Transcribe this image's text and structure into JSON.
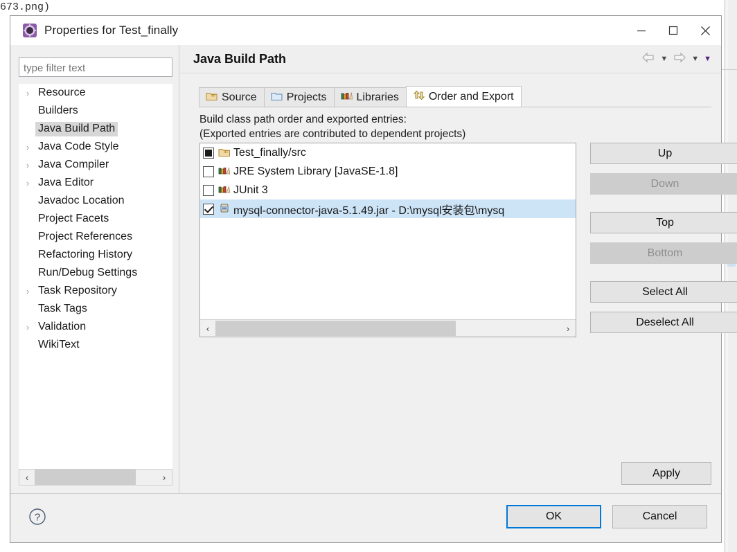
{
  "background": {
    "text_fragment": "673.png)"
  },
  "window": {
    "title": "Properties for Test_finally",
    "icon": "eclipse-icon",
    "controls": {
      "minimize": "minimize-icon",
      "maximize": "maximize-icon",
      "close": "close-icon"
    }
  },
  "sidebar": {
    "filter": {
      "value": "",
      "placeholder": "type filter text"
    },
    "items": [
      {
        "label": "Resource",
        "expandable": true,
        "selected": false
      },
      {
        "label": "Builders",
        "expandable": false,
        "selected": false
      },
      {
        "label": "Java Build Path",
        "expandable": false,
        "selected": true
      },
      {
        "label": "Java Code Style",
        "expandable": true,
        "selected": false
      },
      {
        "label": "Java Compiler",
        "expandable": true,
        "selected": false
      },
      {
        "label": "Java Editor",
        "expandable": true,
        "selected": false
      },
      {
        "label": "Javadoc Location",
        "expandable": false,
        "selected": false
      },
      {
        "label": "Project Facets",
        "expandable": false,
        "selected": false
      },
      {
        "label": "Project References",
        "expandable": false,
        "selected": false
      },
      {
        "label": "Refactoring History",
        "expandable": false,
        "selected": false
      },
      {
        "label": "Run/Debug Settings",
        "expandable": false,
        "selected": false
      },
      {
        "label": "Task Repository",
        "expandable": true,
        "selected": false
      },
      {
        "label": "Task Tags",
        "expandable": false,
        "selected": false
      },
      {
        "label": "Validation",
        "expandable": true,
        "selected": false
      },
      {
        "label": "WikiText",
        "expandable": false,
        "selected": false
      }
    ],
    "scrollbar": {
      "left_arrow": "‹",
      "right_arrow": "›"
    }
  },
  "page": {
    "title": "Java Build Path",
    "nav": {
      "back": "back-arrow-icon",
      "back_caret": "▼",
      "forward": "forward-arrow-icon",
      "forward_caret": "▼",
      "menu_caret": "▼"
    },
    "tabs": [
      {
        "label": "Source",
        "icon": "source-folder-icon",
        "active": false
      },
      {
        "label": "Projects",
        "icon": "projects-folder-icon",
        "active": false
      },
      {
        "label": "Libraries",
        "icon": "libraries-books-icon",
        "active": false
      },
      {
        "label": "Order and Export",
        "icon": "order-export-icon",
        "active": true
      }
    ],
    "description_line1": "Build class path order and exported entries:",
    "description_line2": "(Exported entries are contributed to dependent projects)",
    "entries": [
      {
        "label": "Test_finally/src",
        "icon": "source-folder-icon",
        "checkbox": "filled",
        "selected": false
      },
      {
        "label": "JRE System Library [JavaSE-1.8]",
        "icon": "libraries-books-icon",
        "checkbox": "unchecked",
        "selected": false
      },
      {
        "label": "JUnit 3",
        "icon": "libraries-books-icon",
        "checkbox": "unchecked",
        "selected": false
      },
      {
        "label": "mysql-connector-java-5.1.49.jar - D:\\mysql安装包\\mysq",
        "icon": "jar-icon",
        "checkbox": "checked",
        "selected": true
      }
    ],
    "list_scrollbar": {
      "left_arrow": "‹",
      "right_arrow": "›"
    },
    "side_buttons": [
      {
        "label": "Up",
        "enabled": true
      },
      {
        "label": "Down",
        "enabled": false
      },
      {
        "label": "Top",
        "enabled": true
      },
      {
        "label": "Bottom",
        "enabled": false
      },
      {
        "label": "Select All",
        "enabled": true
      },
      {
        "label": "Deselect All",
        "enabled": true
      }
    ],
    "apply_label": "Apply"
  },
  "footer": {
    "help": "?",
    "ok_label": "OK",
    "cancel_label": "Cancel"
  },
  "colors": {
    "accent": "#0078d7",
    "selection": "#cde4f7",
    "tree_selection": "#d7d7d7",
    "dialog_bg": "#f0f0f0"
  }
}
